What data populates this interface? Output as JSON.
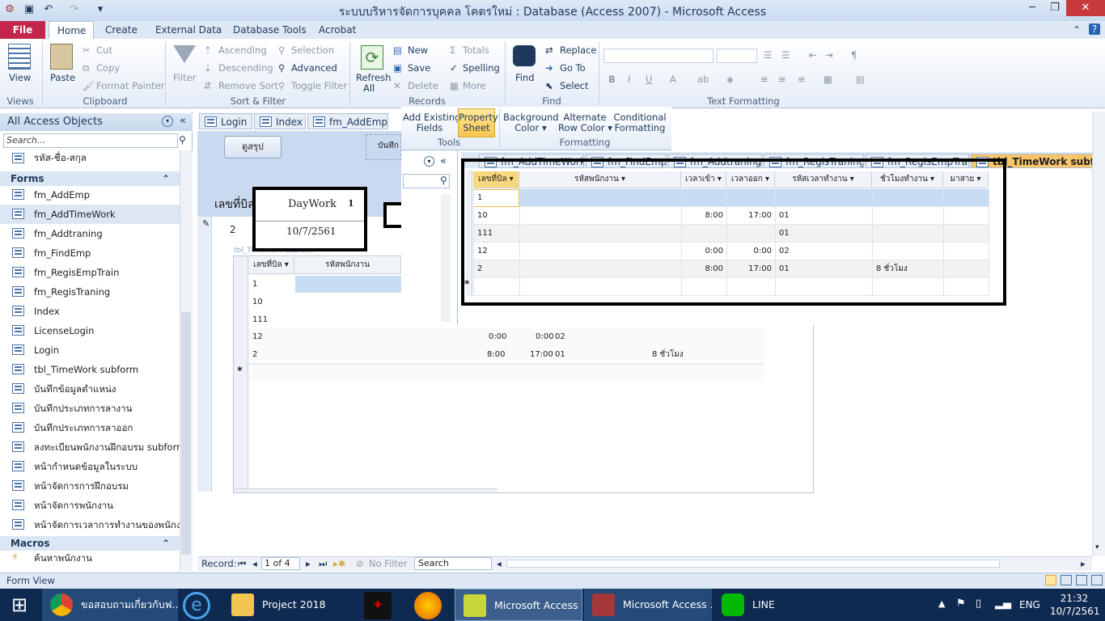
{
  "window": {
    "title": "ระบบบริหารจัดการบุคคล โคตรใหม่ : Database (Access 2007)  -  Microsoft Access"
  },
  "ribbon_tabs": [
    "File",
    "Home",
    "Create",
    "External Data",
    "Database Tools",
    "Acrobat"
  ],
  "ribbon": {
    "views": {
      "view_label": "View",
      "group": "Views"
    },
    "clipboard": {
      "paste": "Paste",
      "cut": "Cut",
      "copy": "Copy",
      "format_painter": "Format Painter",
      "group": "Clipboard"
    },
    "sort_filter": {
      "filter": "Filter",
      "ascending": "Ascending",
      "descending": "Descending",
      "remove_sort": "Remove Sort",
      "selection": "Selection",
      "advanced": "Advanced",
      "toggle_filter": "Toggle Filter",
      "group": "Sort & Filter"
    },
    "records": {
      "refresh": "Refresh",
      "refresh_all": "All",
      "new": "New",
      "save": "Save",
      "delete": "Delete",
      "totals": "Totals",
      "spelling": "Spelling",
      "more": "More",
      "group": "Records"
    },
    "find": {
      "find": "Find",
      "replace": "Replace",
      "goto": "Go To",
      "select": "Select",
      "group": "Find"
    },
    "text_formatting": {
      "group": "Text Formatting",
      "bold": "B",
      "italic": "I",
      "underline": "U"
    }
  },
  "ribbon_overlay": {
    "add_existing_fields": [
      "Add Existing",
      "Fields"
    ],
    "property_sheet": [
      "Property",
      "Sheet"
    ],
    "background_color": [
      "Background",
      "Color"
    ],
    "alternate_row_color": [
      "Alternate",
      "Row Color"
    ],
    "conditional_formatting": [
      "Conditional",
      "Formatting"
    ],
    "group_tools": "Tools",
    "group_formatting": "Formatting"
  },
  "nav": {
    "title": "All Access Objects",
    "search_placeholder": "Search...",
    "top_item": "รหัส-ชื่อ-สกุล",
    "forms_label": "Forms",
    "forms": [
      "fm_AddEmp",
      "fm_AddTimeWork",
      "fm_Addtraning",
      "fm_FindEmp",
      "fm_RegisEmpTrain",
      "fm_RegisTraning",
      "Index",
      "LicenseLogin",
      "Login",
      "tbl_TimeWork subform",
      "บันทึกข้อมูลตำแหน่ง",
      "บันทึกประเภทการลางาน",
      "บันทึกประเภทการลาออก",
      "ลงทะเบียนพนักงานฝึกอบรม subform",
      "หน้ากำหนดข้อมูลในระบบ",
      "หน้าจัดการการฝึกอบรม",
      "หน้าจัดการพนักงาน",
      "หน้าจัดการเวลาการทำงานของพนักง..."
    ],
    "macros_label": "Macros",
    "macros": [
      "ค้นหาพนักงาน"
    ]
  },
  "doc_tabs": [
    "Login",
    "Index",
    "fm_AddEmp"
  ],
  "doc_tabs_overlay": [
    "fm_AddTimeWork",
    "fm_FindEmp",
    "fm_Addtraning",
    "fm_RegisTraning",
    "fm_RegisEmpTrain",
    "tbl_TimeWork subform"
  ],
  "form": {
    "summary_button": "ดูสรุป",
    "record_button_partial": "บันทึก",
    "field_label": "เลขที่บิล",
    "field_value": "2",
    "subform_label": "tbl_TimeWork subform",
    "daywork": {
      "label": "DayWork",
      "number": "1",
      "date": "10/7/2561"
    }
  },
  "grid": {
    "columns": [
      "เลขที่บิล",
      "รหัสพนักงาน",
      "เวลาเข้า",
      "เวลาออก",
      "รหัสเวลาทำงาน",
      "ชั่วโมงทำงาน",
      "มาสาย"
    ],
    "rows": [
      [
        "1",
        "",
        "",
        "",
        "",
        "",
        ""
      ],
      [
        "10",
        "",
        "8:00",
        "17:00",
        "01",
        "",
        ""
      ],
      [
        "111",
        "",
        "",
        "",
        "01",
        "",
        ""
      ],
      [
        "12",
        "",
        "0:00",
        "0:00",
        "02",
        "",
        ""
      ],
      [
        "2",
        "",
        "8:00",
        "17:00",
        "01",
        "8 ชั่วโมง",
        ""
      ]
    ]
  },
  "record_nav": {
    "label": "Record:",
    "position": "1 of 4",
    "filter": "No Filter",
    "search": "Search"
  },
  "status": {
    "text": "Form View"
  },
  "taskbar": {
    "apps": [
      "ขอสอบถามเกี่ยวกับฟ...",
      "Project 2018",
      "Microsoft Access ...",
      "Microsoft Access ...",
      "LINE"
    ],
    "lang": "ENG",
    "time": "21:32",
    "date": "10/7/2561"
  }
}
